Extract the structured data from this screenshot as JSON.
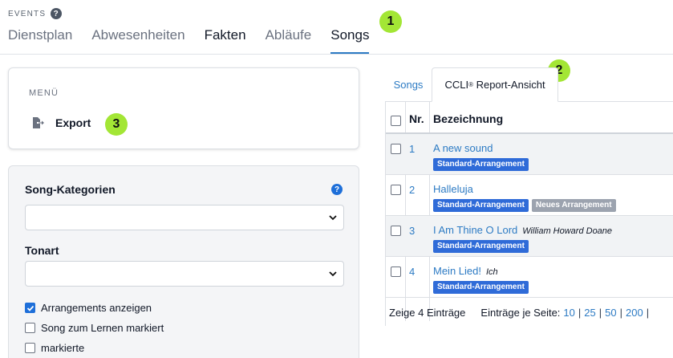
{
  "header": {
    "section_label": "EVENTS",
    "help_glyph": "?",
    "tabs": [
      {
        "label": "Dienstplan",
        "state": "muted"
      },
      {
        "label": "Abwesenheiten",
        "state": "muted"
      },
      {
        "label": "Fakten",
        "state": "dark"
      },
      {
        "label": "Abläufe",
        "state": "muted"
      },
      {
        "label": "Songs",
        "state": "active"
      }
    ]
  },
  "annotations": [
    "1",
    "2",
    "3"
  ],
  "menu": {
    "title": "MENÜ",
    "export_label": "Export",
    "export_icon": "file-export-icon"
  },
  "filters": {
    "category_label": "Song-Kategorien",
    "category_value": "",
    "key_label": "Tonart",
    "key_value": "",
    "help_glyph": "?",
    "checkboxes": [
      {
        "label": "Arrangements anzeigen",
        "checked": true
      },
      {
        "label": "Song zum Lernen markiert",
        "checked": false
      },
      {
        "label": "markierte",
        "checked": false
      }
    ]
  },
  "view_tabs": {
    "songs": "Songs",
    "ccli_prefix": "CCLI",
    "ccli_reg": "®",
    "ccli_suffix": " Report-Ansicht"
  },
  "table": {
    "columns": {
      "nr": "Nr.",
      "name": "Bezeichnung"
    },
    "rows": [
      {
        "nr": "1",
        "title": "A new sound",
        "author": "",
        "tags": [
          {
            "label": "Standard-Arrangement",
            "color": "blue"
          }
        ]
      },
      {
        "nr": "2",
        "title": "Halleluja",
        "author": "",
        "tags": [
          {
            "label": "Standard-Arrangement",
            "color": "blue"
          },
          {
            "label": "Neues Arrangement",
            "color": "gray"
          }
        ]
      },
      {
        "nr": "3",
        "title": "I Am Thine O Lord",
        "author": "William Howard Doane",
        "tags": [
          {
            "label": "Standard-Arrangement",
            "color": "blue"
          }
        ]
      },
      {
        "nr": "4",
        "title": "Mein Lied!",
        "author": "Ich",
        "tags": [
          {
            "label": "Standard-Arrangement",
            "color": "blue"
          }
        ]
      }
    ],
    "footer": {
      "count_text": "Zeige 4 Einträge",
      "per_page_label": "Einträge je Seite:",
      "page_sizes": [
        "10",
        "25",
        "50",
        "200"
      ]
    }
  },
  "colors": {
    "accent": "#2d7bc4",
    "badge": "#a3e635",
    "tag_blue": "#2f6bd8",
    "tag_gray": "#9ca3af"
  }
}
